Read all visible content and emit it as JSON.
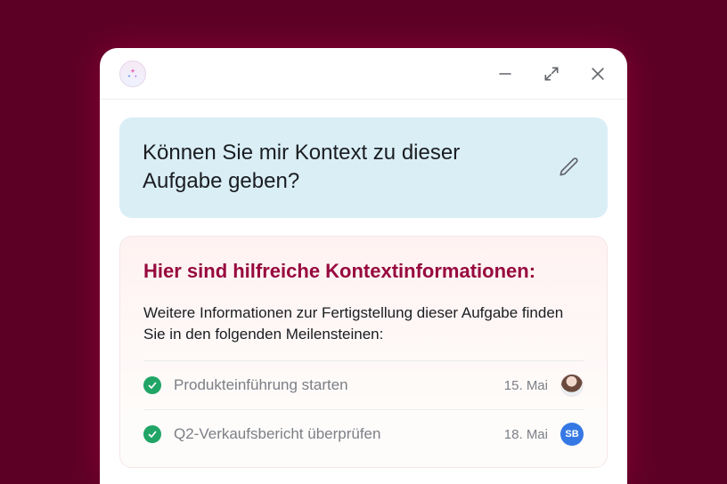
{
  "question": {
    "text": "Können Sie mir Kontext zu dieser Aufgabe geben?"
  },
  "answer": {
    "title": "Hier sind hilfreiche Kontextinformationen:",
    "lead": "Weitere Informationen zur Fertigstellung dieser Aufgabe finden Sie in den folgenden Meilensteinen:",
    "milestones": [
      {
        "name": "Produkteinführung starten",
        "date": "15. Mai",
        "avatar_type": "photo",
        "avatar_label": ""
      },
      {
        "name": "Q2-Verkaufsbericht überprüfen",
        "date": "18. Mai",
        "avatar_type": "initials",
        "avatar_label": "SB"
      }
    ]
  }
}
